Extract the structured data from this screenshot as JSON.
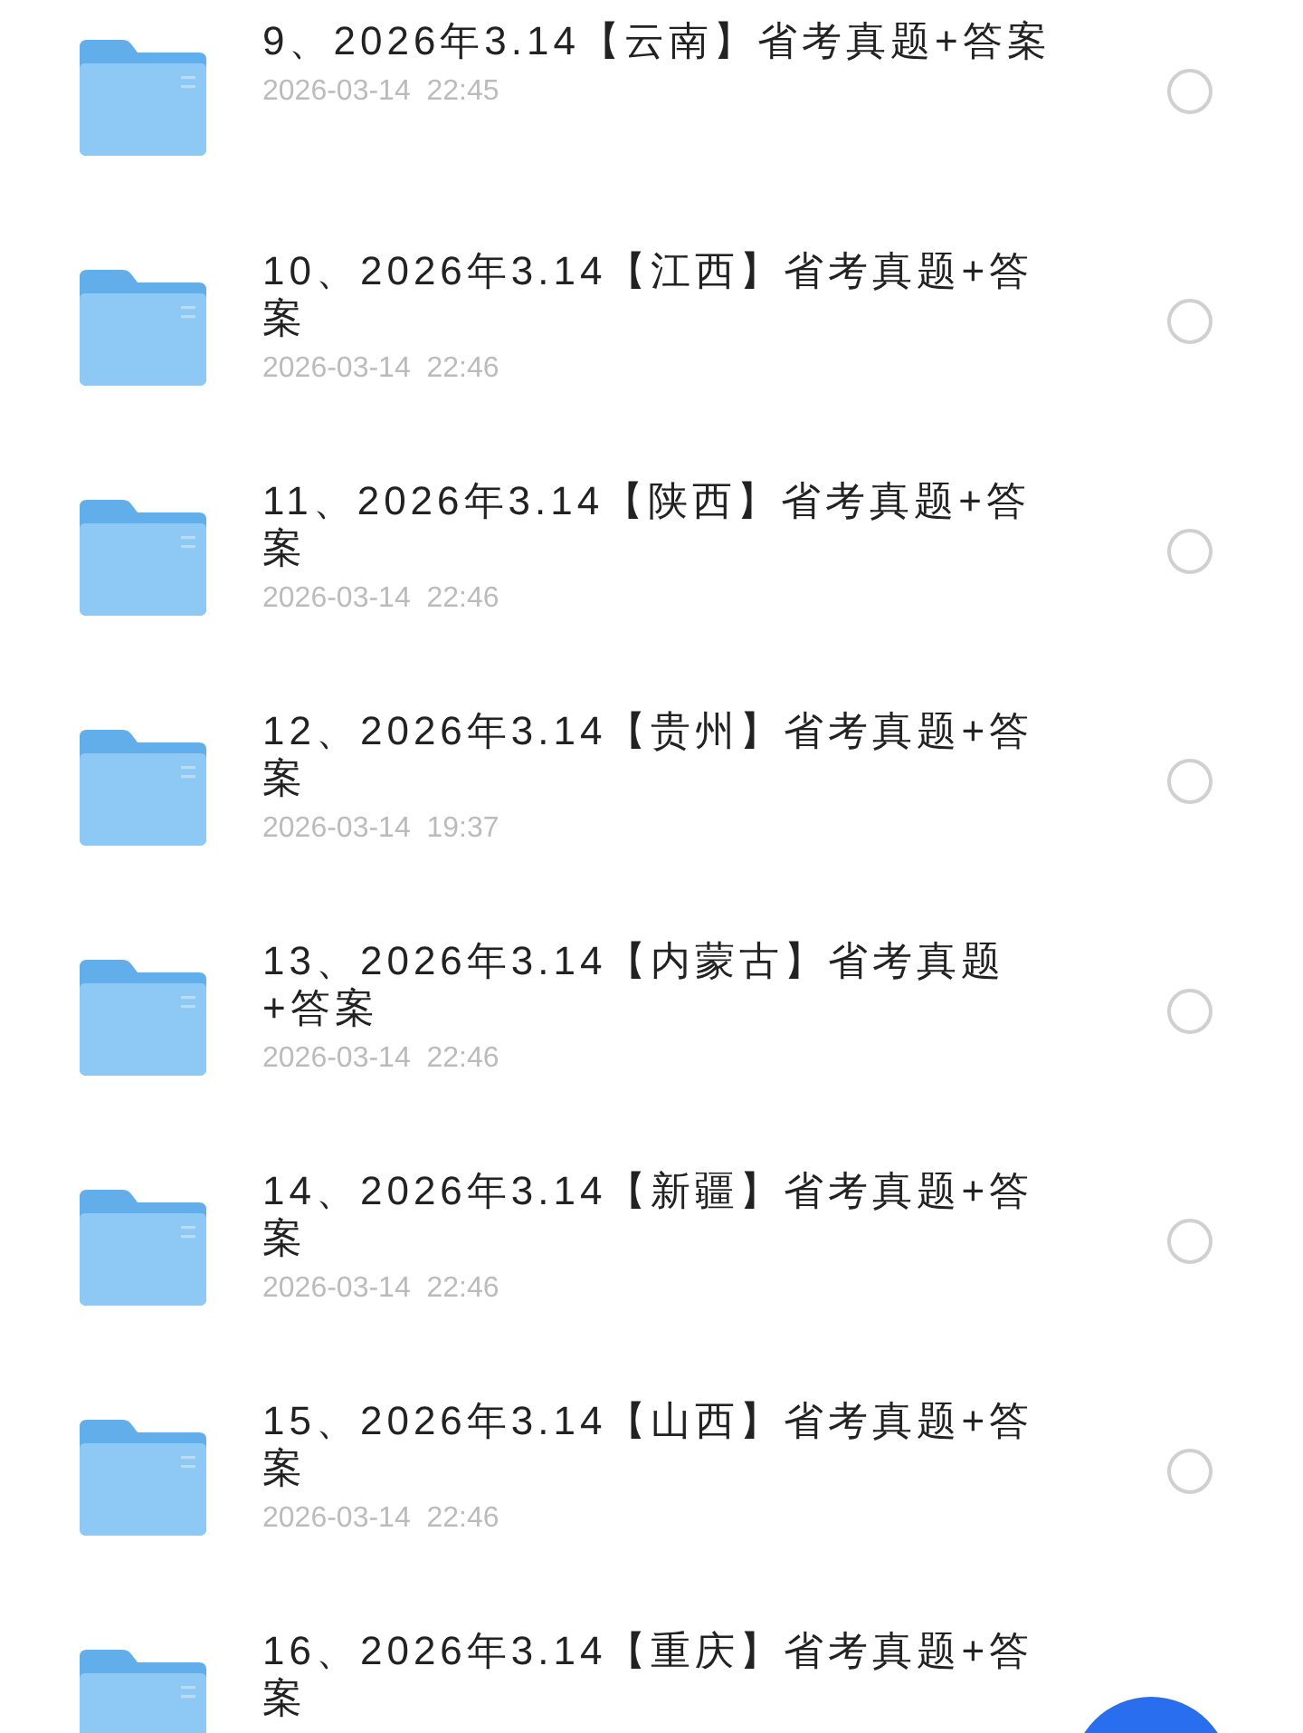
{
  "files": [
    {
      "title": "9、2026年3.14【云南】省考真题+答案",
      "date": "2026-03-14  22:45",
      "selected": false
    },
    {
      "title": "10、2026年3.14【江西】省考真题+答案",
      "date": "2026-03-14  22:46",
      "selected": false
    },
    {
      "title": "11、2026年3.14【陕西】省考真题+答案",
      "date": "2026-03-14  22:46",
      "selected": false
    },
    {
      "title": "12、2026年3.14【贵州】省考真题+答案",
      "date": "2026-03-14  19:37",
      "selected": false
    },
    {
      "title": "13、2026年3.14【内蒙古】省考真题+答案",
      "date": "2026-03-14  22:46",
      "selected": false
    },
    {
      "title": "14、2026年3.14【新疆】省考真题+答案",
      "date": "2026-03-14  22:46",
      "selected": false
    },
    {
      "title": "15、2026年3.14【山西】省考真题+答案",
      "date": "2026-03-14  22:46",
      "selected": false
    },
    {
      "title": "16、2026年3.14【重庆】省考真题+答案"
    }
  ]
}
